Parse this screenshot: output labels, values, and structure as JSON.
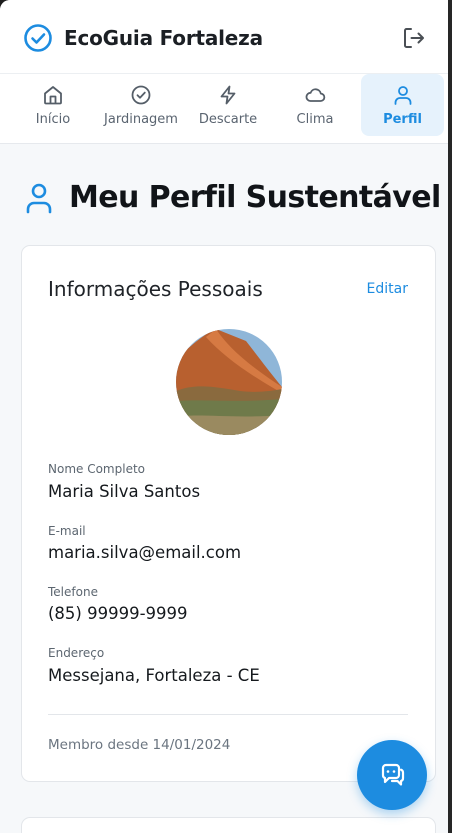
{
  "header": {
    "app_title": "EcoGuia Fortaleza"
  },
  "nav": {
    "tabs": [
      {
        "label": "Início",
        "icon": "home-icon"
      },
      {
        "label": "Jardinagem",
        "icon": "check-circle-icon"
      },
      {
        "label": "Descarte",
        "icon": "lightning-icon"
      },
      {
        "label": "Clima",
        "icon": "cloud-icon"
      },
      {
        "label": "Perfil",
        "icon": "user-icon",
        "active": true
      }
    ]
  },
  "page": {
    "title": "Meu Perfil Sustentável"
  },
  "profile_card": {
    "title": "Informações Pessoais",
    "edit_label": "Editar",
    "fields": [
      {
        "label": "Nome Completo",
        "value": "Maria Silva Santos"
      },
      {
        "label": "E-mail",
        "value": "maria.silva@email.com"
      },
      {
        "label": "Telefone",
        "value": "(85) 99999-9999"
      },
      {
        "label": "Endereço",
        "value": "Messejana, Fortaleza - CE"
      }
    ],
    "member_since": "Membro desde 14/01/2024"
  },
  "colors": {
    "accent": "#1d8ce0",
    "active_tab_bg": "#e6f2fc",
    "page_bg": "#f6f8fa"
  }
}
